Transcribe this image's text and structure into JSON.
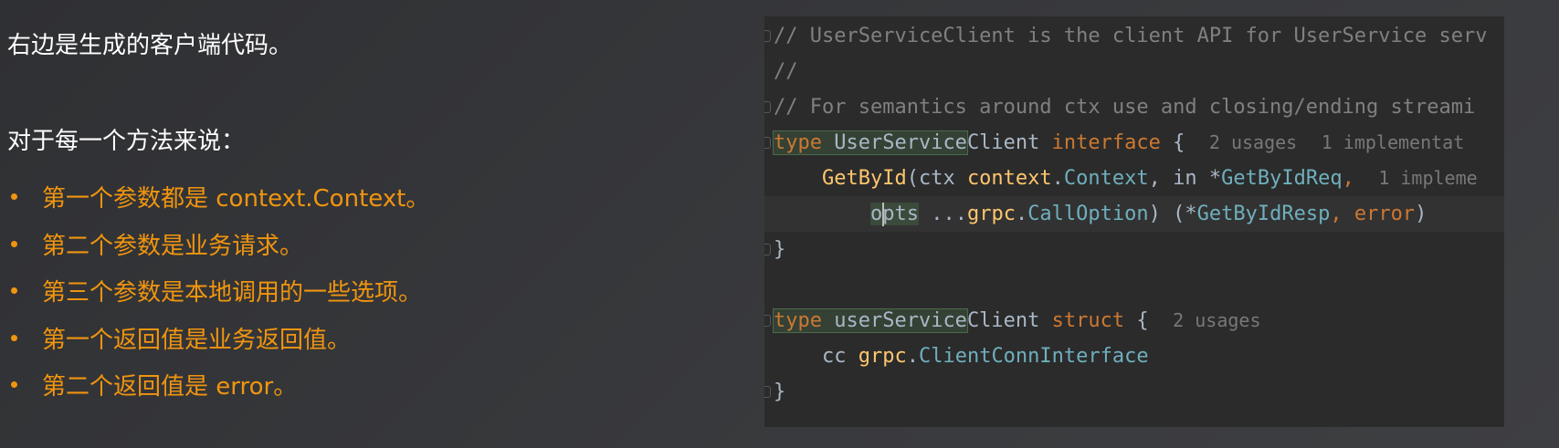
{
  "slide": {
    "intro": "右边是生成的客户端代码。",
    "subhead": "对于每一个方法来说：",
    "bullets": [
      "第一个参数都是 context.Context。",
      "第二个参数是业务请求。",
      "第三个参数是本地调用的一些选项。",
      "第一个返回值是业务返回值。",
      "第二个返回值是 error。"
    ]
  },
  "code": {
    "line1": "// UserServiceClient is the client API for UserService serv",
    "line2": "//",
    "line3": "// For semantics around ctx use and closing/ending streami",
    "line4": {
      "kw_type": "type",
      "name_hl": "UserService",
      "name_rest": "Client",
      "kw_interface": "interface",
      "brace": " {",
      "hint_usages": "2 usages",
      "hint_impl": "1 implementat"
    },
    "line5": {
      "func": "GetById",
      "p1": "(ctx ",
      "pkg": "context",
      "dot": ".",
      "type": "Context",
      "p2": ", in *",
      "req": "GetByIdReq",
      "comma": ",",
      "hint": "1 impleme"
    },
    "line6": {
      "opts_first": "o",
      "opts_rest": "pts",
      "p1": " ...",
      "pkg": "grpc",
      "dot": ".",
      "type": "CallOption",
      "p2": ") (*",
      "resp": "GetByIdResp",
      "p3": ", ",
      "err": "error",
      "p4": ")"
    },
    "line7": "}",
    "line9": {
      "kw_type": "type",
      "name_hl": "userService",
      "name_rest": "Client",
      "kw_struct": "struct",
      "brace": " {",
      "hint_usages": "2 usages"
    },
    "line10": {
      "field": "cc ",
      "pkg": "grpc",
      "dot": ".",
      "type": "ClientConnInterface"
    },
    "line11": "}"
  },
  "colors": {
    "accent": "#f0950f",
    "keyword": "#cc7832",
    "function": "#ffc66d",
    "type": "#6fafbd",
    "comment": "#808080"
  }
}
